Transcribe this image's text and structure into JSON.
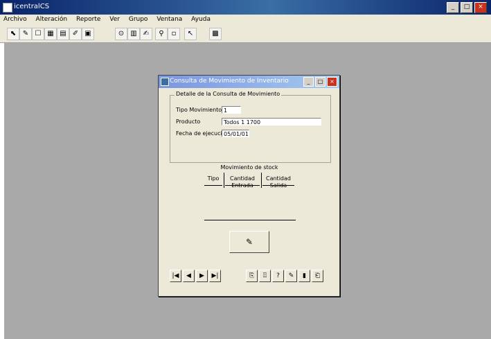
{
  "window": {
    "title": "icentralCS",
    "btn_minimize": "_",
    "btn_maximize": "□",
    "btn_close": "×"
  },
  "menu": [
    "Archivo",
    "Alteración",
    "Reporte",
    "Ver",
    "Grupo",
    "Ventana",
    "Ayuda"
  ],
  "toolbar": [
    "⬉",
    "✎",
    "☐",
    "▦",
    "▤",
    "✐",
    "▣",
    "⊙",
    "▥",
    "✍",
    "⚲",
    "▫",
    "↖",
    "▩"
  ],
  "dialog": {
    "title": "Consulta de Movimiento de Inventario",
    "group_title": "Detalle de la Consulta de Movimiento",
    "labels": {
      "field1": "Tipo Movimiento",
      "field2": "Producto",
      "field3": "Fecha de ejecución"
    },
    "values": {
      "field1": "1",
      "field2": "Todos 1 1700",
      "field3": "05/01/01"
    },
    "table_header": "Movimiento de stock",
    "columns": [
      "Tipo",
      "Cantidad Entrada",
      "Cantidad Salida"
    ],
    "big_button_glyph": "✎",
    "nav": [
      "|◀",
      "◀",
      "▶",
      "▶|"
    ],
    "actions": [
      "⎘",
      "⍐",
      "?",
      "✎",
      "▮",
      "⎗"
    ]
  }
}
